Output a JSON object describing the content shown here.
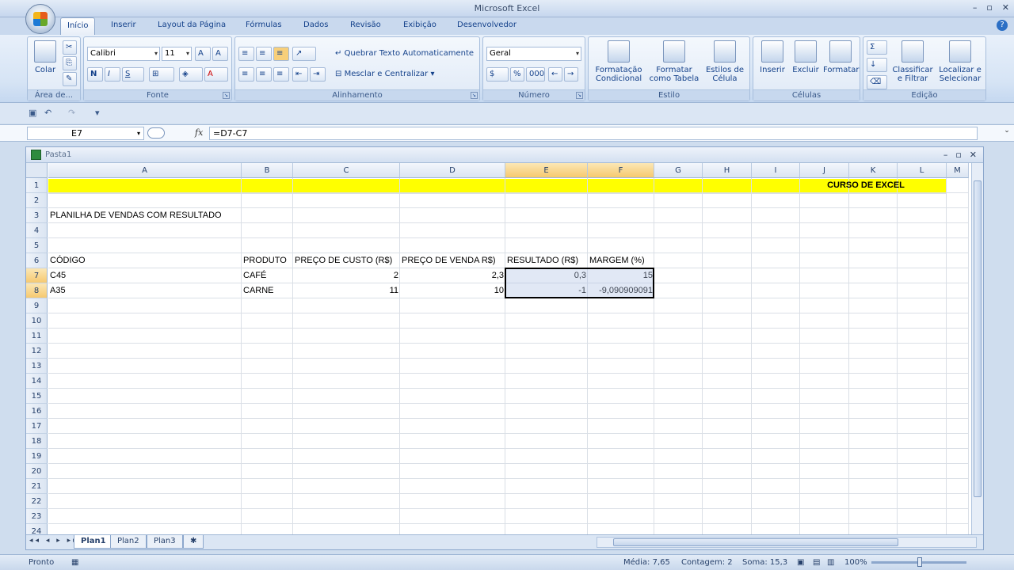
{
  "app": {
    "title": "Microsoft Excel"
  },
  "tabs": [
    "Início",
    "Inserir",
    "Layout da Página",
    "Fórmulas",
    "Dados",
    "Revisão",
    "Exibição",
    "Desenvolvedor"
  ],
  "ribbon": {
    "clipboard": {
      "label": "Área de...",
      "paste": "Colar"
    },
    "font": {
      "label": "Fonte",
      "name": "Calibri",
      "size": "11",
      "bold": "N",
      "italic": "I",
      "underline": "S"
    },
    "alignment": {
      "label": "Alinhamento",
      "wrap": "Quebrar Texto Automaticamente",
      "merge": "Mesclar e Centralizar"
    },
    "number": {
      "label": "Número",
      "format": "Geral",
      "percent": "%",
      "thousands": "000"
    },
    "style": {
      "label": "Estilo",
      "conditional": "Formatação Condicional",
      "table": "Formatar como Tabela",
      "cell": "Estilos de Célula"
    },
    "cells": {
      "label": "Células",
      "insert": "Inserir",
      "delete": "Excluir",
      "format": "Formatar"
    },
    "editing": {
      "label": "Edição",
      "sort": "Classificar e Filtrar",
      "find": "Localizar e Selecionar"
    }
  },
  "formula_bar": {
    "name_box": "E7",
    "formula": "=D7-C7",
    "fx": "fx"
  },
  "workbook": {
    "title": "Pasta1"
  },
  "columns": [
    "A",
    "B",
    "C",
    "D",
    "E",
    "F",
    "G",
    "H",
    "I",
    "J",
    "K",
    "L",
    "M"
  ],
  "rows": [
    "1",
    "2",
    "3",
    "4",
    "5",
    "6",
    "7",
    "8",
    "9",
    "10",
    "11",
    "12",
    "13",
    "14",
    "15",
    "16",
    "17",
    "18",
    "19",
    "20",
    "21",
    "22",
    "23",
    "24"
  ],
  "sheet": {
    "banner": "CURSO DE EXCEL",
    "heading": "PLANILHA DE VENDAS COM RESULTADO",
    "headers": {
      "a": "CÓDIGO",
      "b": "PRODUTO",
      "c": "PREÇO DE CUSTO (R$)",
      "d": "PREÇO DE VENDA R$)",
      "e": "RESULTADO (R$)",
      "f": "MARGEM (%)"
    },
    "row7": {
      "a": "C45",
      "b": "CAFÉ",
      "c": "2",
      "d": "2,3",
      "e": "0,3",
      "f": "15"
    },
    "row8": {
      "a": "A35",
      "b": "CARNE",
      "c": "11",
      "d": "10",
      "e": "-1",
      "f": "-9,090909091"
    }
  },
  "sheet_tabs": [
    "Plan1",
    "Plan2",
    "Plan3"
  ],
  "status": {
    "ready": "Pronto",
    "average": "Média: 7,65",
    "count": "Contagem: 2",
    "sum": "Soma: 15,3",
    "zoom": "100%"
  },
  "colors": {
    "banner_fill": "#ffff00",
    "selection_header": "#f6c96f"
  }
}
